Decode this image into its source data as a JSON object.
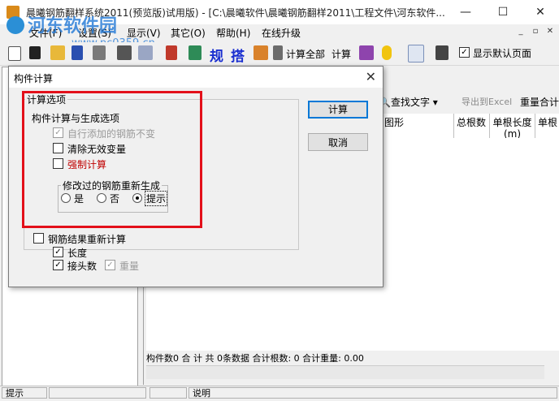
{
  "window": {
    "title": "晨曦钢筋翻样系统2011(预览版)试用版) - [C:\\晨曦软件\\晨曦钢筋翻样2011\\工程文件\\河东软件...",
    "controls": {
      "minimize": "—",
      "maximize": "☐",
      "close": "✕"
    }
  },
  "watermark": {
    "text": "河东软件园",
    "url": "www.pc0359.cn"
  },
  "menu": [
    "文件(F)",
    "设置(S)",
    "显示(V)",
    "其它(O)",
    "帮助(H)",
    "在线升级"
  ],
  "mdi_controls": [
    "_",
    "▫",
    "✕"
  ],
  "toolbar": {
    "gui_label": "规",
    "da_label": "搭",
    "calc_all_label": "计算全部",
    "calc_label": "计算",
    "show_default_page_label": "显示默认页面",
    "show_default_page_checked": true
  },
  "right_toolbar": {
    "find_text": "查找文字",
    "export_excel": "导出到Excel",
    "reset_total": "重量合计"
  },
  "grid": {
    "headers": [
      "图形",
      "总根数",
      "单根长度(m)",
      "单根"
    ]
  },
  "summary_text": "构件数0  合 计   共 0条数据  合计根数: 0  合计重量: 0.00",
  "statusbar": {
    "hint": "提示",
    "desc": "说明"
  },
  "dialog": {
    "title": "构件计算",
    "close_glyph": "✕",
    "group_title": "计算选项",
    "section_label": "构件计算与生成选项",
    "options": [
      {
        "label": "自行添加的钢筋不变",
        "checked": true,
        "disabled": true
      },
      {
        "label": "清除无效变量",
        "checked": false,
        "disabled": false
      },
      {
        "label": "强制计算",
        "checked": false,
        "disabled": false,
        "color": "#c00000"
      }
    ],
    "regen_group_title": "修改过的钢筋重新生成",
    "regen_options": [
      {
        "label": "是",
        "selected": false
      },
      {
        "label": "否",
        "selected": false
      },
      {
        "label": "提示",
        "selected": true
      }
    ],
    "recalc_label": "钢筋结果重新计算",
    "recalc_checked": false,
    "recalc_sub": [
      {
        "label": "长度",
        "checked": true,
        "disabled": false
      },
      {
        "label": "接头数",
        "checked": true,
        "disabled": false
      },
      {
        "label": "重量",
        "checked": true,
        "disabled": true
      }
    ],
    "buttons": {
      "calc": "计算",
      "cancel": "取消"
    }
  },
  "colors": {
    "highlight": "#e3101a",
    "watermark": "#2d7fd8",
    "focus": "#0078d7"
  }
}
